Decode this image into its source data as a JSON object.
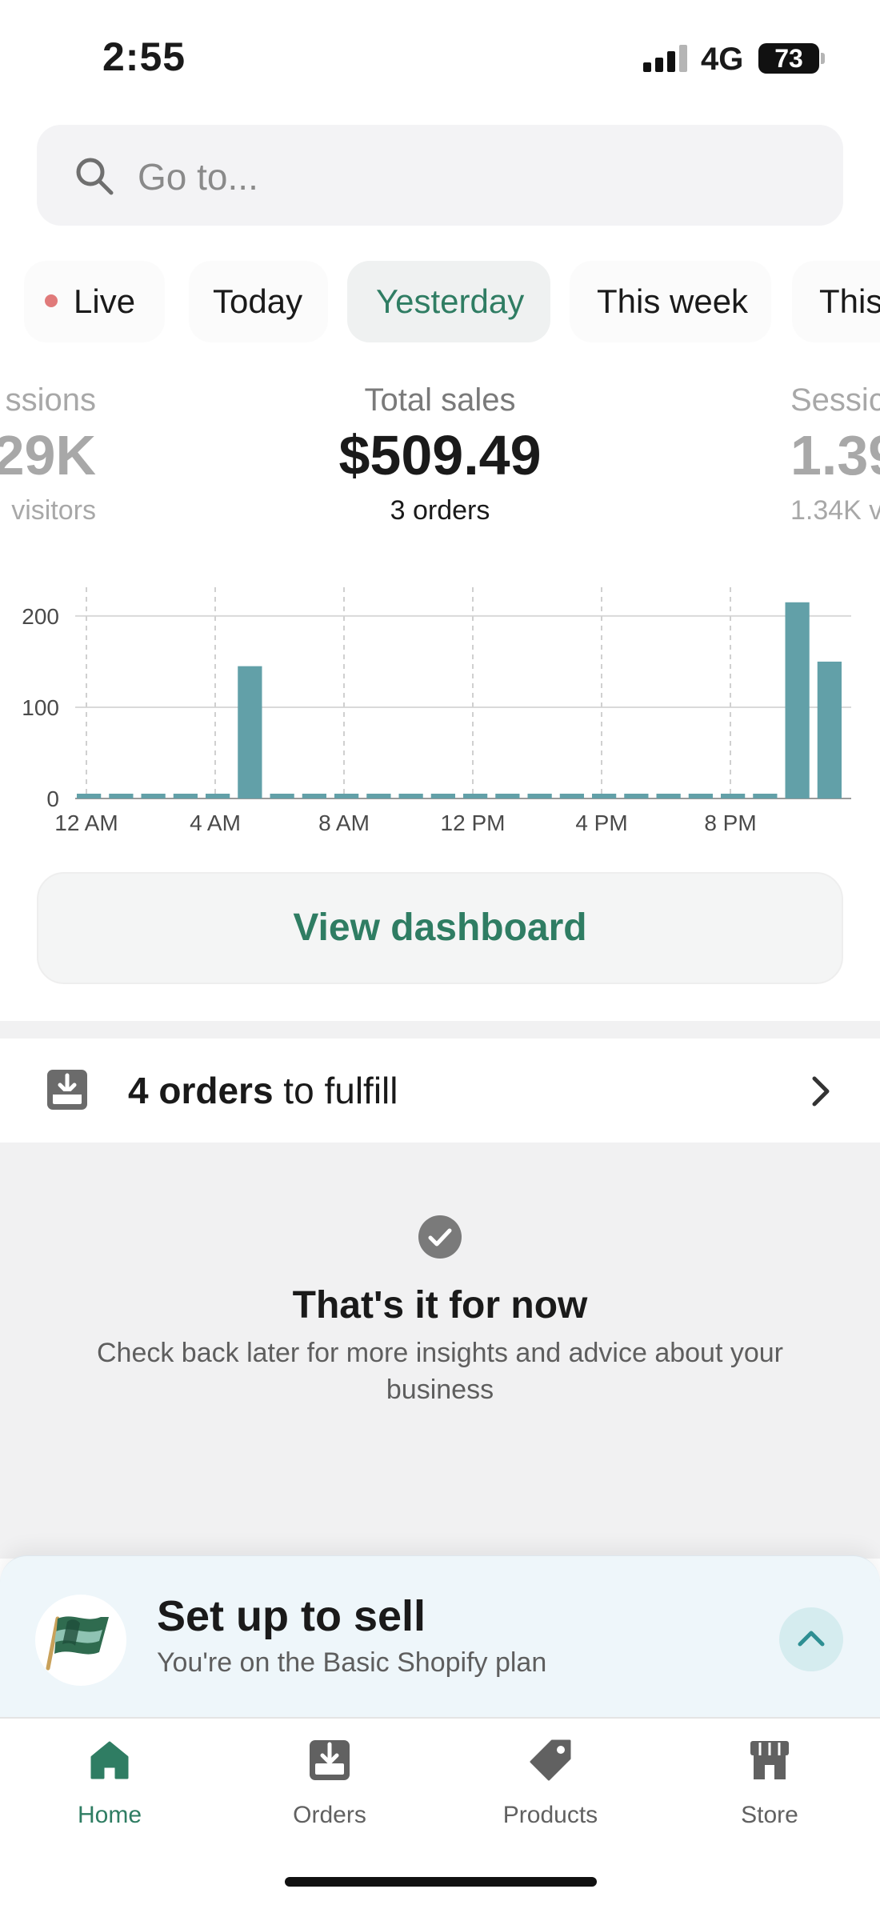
{
  "status_bar": {
    "time": "2:55",
    "network": "4G",
    "battery": "73"
  },
  "search": {
    "placeholder": "Go to..."
  },
  "ranges": [
    {
      "label": "Live"
    },
    {
      "label": "Today"
    },
    {
      "label": "Yesterday"
    },
    {
      "label": "This week"
    },
    {
      "label": "This"
    }
  ],
  "selected_range": "Yesterday",
  "metrics": {
    "left": {
      "label": "ssions",
      "value": "29K",
      "sub": "visitors"
    },
    "center": {
      "label": "Total sales",
      "value": "$509.49",
      "sub": "3 orders"
    },
    "right": {
      "label": "Sessic",
      "value": "1.39",
      "sub": "1.34K v"
    }
  },
  "chart_data": {
    "type": "bar",
    "x": [
      "12 AM",
      "1 AM",
      "2 AM",
      "3 AM",
      "4 AM",
      "5 AM",
      "6 AM",
      "7 AM",
      "8 AM",
      "9 AM",
      "10 AM",
      "11 AM",
      "12 PM",
      "1 PM",
      "2 PM",
      "3 PM",
      "4 PM",
      "5 PM",
      "6 PM",
      "7 PM",
      "8 PM",
      "9 PM",
      "10 PM",
      "11 PM"
    ],
    "values": [
      0,
      0,
      0,
      0,
      0,
      145,
      0,
      0,
      0,
      0,
      0,
      0,
      0,
      0,
      0,
      0,
      0,
      0,
      0,
      0,
      0,
      0,
      215,
      150
    ],
    "x_tick_labels": [
      "12 AM",
      "4 AM",
      "8 AM",
      "12 PM",
      "4 PM",
      "8 PM"
    ],
    "y_ticks": [
      0,
      100,
      200
    ],
    "ylim": [
      0,
      235
    ],
    "bar_color": "#62a0a8"
  },
  "dashboard_button": {
    "label": "View dashboard"
  },
  "fulfill": {
    "count": "4 orders",
    "suffix": " to fulfill"
  },
  "empty_state": {
    "title": "That's it for now",
    "body": "Check back later for more insights and advice about your business"
  },
  "setup": {
    "title": "Set up to sell",
    "subtitle": "You're on the Basic Shopify plan"
  },
  "tabs": [
    {
      "label": "Home",
      "icon": "home-icon"
    },
    {
      "label": "Orders",
      "icon": "orders-icon"
    },
    {
      "label": "Products",
      "icon": "tag-icon"
    },
    {
      "label": "Store",
      "icon": "store-icon"
    }
  ],
  "colors": {
    "accent": "#2f7d63",
    "bar": "#62a0a8",
    "live_dot": "#e07a7a"
  }
}
